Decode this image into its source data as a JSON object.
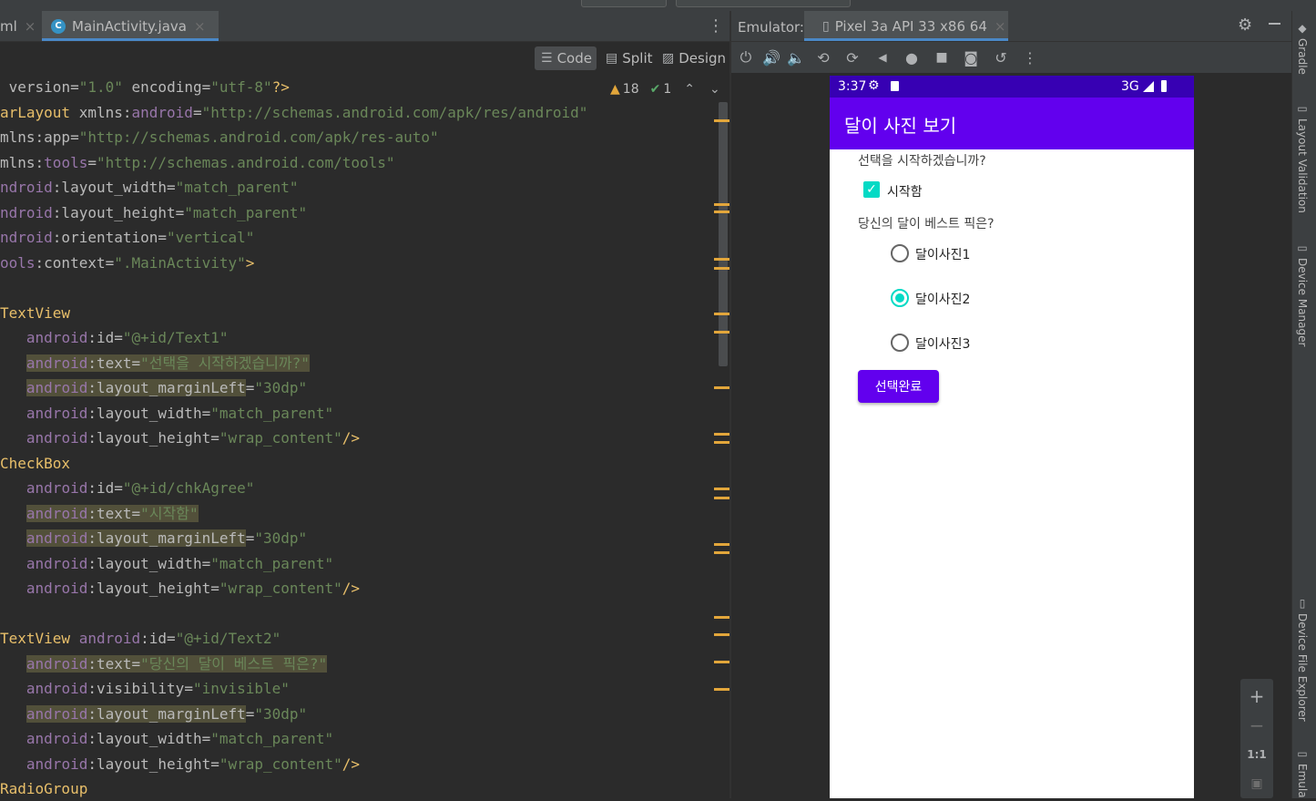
{
  "editor": {
    "tabs": [
      {
        "label": "ml",
        "close": "×"
      },
      {
        "label": "MainActivity.java",
        "close": "×",
        "icon": "C"
      }
    ],
    "kebab": "⋮",
    "modes": {
      "code": "Code",
      "split": "Split",
      "design": "Design"
    },
    "inspections": {
      "warnings": "18",
      "weak_warnings": "1"
    },
    "lines": [
      [
        [
          "punc",
          " "
        ],
        [
          "attr",
          "version"
        ],
        [
          "punc",
          "="
        ],
        [
          "val",
          "\"1.0\""
        ],
        [
          "punc",
          " "
        ],
        [
          "attr",
          "encoding"
        ],
        [
          "punc",
          "="
        ],
        [
          "val",
          "\"utf-8\""
        ],
        [
          "tag",
          "?>"
        ]
      ],
      [
        [
          "tag",
          "arLayout"
        ],
        [
          "punc",
          " "
        ],
        [
          "attr",
          "xmlns:"
        ],
        [
          "ns",
          "android"
        ],
        [
          "punc",
          "="
        ],
        [
          "val",
          "\"http://schemas.android.com/apk/res/android\""
        ]
      ],
      [
        [
          "attr",
          "mlns:app"
        ],
        [
          "punc",
          "="
        ],
        [
          "val",
          "\"http://schemas.android.com/apk/res-auto\""
        ]
      ],
      [
        [
          "attr",
          "mlns:"
        ],
        [
          "ns",
          "tools"
        ],
        [
          "punc",
          "="
        ],
        [
          "val",
          "\"http://schemas.android.com/tools\""
        ]
      ],
      [
        [
          "ns",
          "ndroid"
        ],
        [
          "attr",
          ":layout_width"
        ],
        [
          "punc",
          "="
        ],
        [
          "val",
          "\"match_parent\""
        ]
      ],
      [
        [
          "ns",
          "ndroid"
        ],
        [
          "attr",
          ":layout_height"
        ],
        [
          "punc",
          "="
        ],
        [
          "val",
          "\"match_parent\""
        ]
      ],
      [
        [
          "ns",
          "ndroid"
        ],
        [
          "attr",
          ":orientation"
        ],
        [
          "punc",
          "="
        ],
        [
          "val",
          "\"vertical\""
        ]
      ],
      [
        [
          "ns",
          "ools"
        ],
        [
          "attr",
          ":context"
        ],
        [
          "punc",
          "="
        ],
        [
          "val",
          "\".MainActivity\""
        ],
        [
          "tag",
          ">"
        ]
      ],
      [],
      [
        [
          "tag",
          "TextView"
        ]
      ],
      [
        [
          "punc",
          "   "
        ],
        [
          "ns",
          "android"
        ],
        [
          "attr",
          ":id"
        ],
        [
          "punc",
          "="
        ],
        [
          "val",
          "\"@+id/Text1\""
        ]
      ],
      [
        [
          "punc",
          "   "
        ],
        [
          "hlns",
          "android"
        ],
        [
          "hlattr",
          ":text"
        ],
        [
          "hlpunc",
          "="
        ],
        [
          "hlval",
          "\"선택을 시작하겠습니까?\""
        ]
      ],
      [
        [
          "punc",
          "   "
        ],
        [
          "hlns",
          "android"
        ],
        [
          "hlattr",
          ":layout_marginLeft"
        ],
        [
          "punc",
          "="
        ],
        [
          "val",
          "\"30dp\""
        ]
      ],
      [
        [
          "punc",
          "   "
        ],
        [
          "ns",
          "android"
        ],
        [
          "attr",
          ":layout_width"
        ],
        [
          "punc",
          "="
        ],
        [
          "val",
          "\"match_parent\""
        ]
      ],
      [
        [
          "punc",
          "   "
        ],
        [
          "ns",
          "android"
        ],
        [
          "attr",
          ":layout_height"
        ],
        [
          "punc",
          "="
        ],
        [
          "val",
          "\"wrap_content\""
        ],
        [
          "tag",
          "/>"
        ]
      ],
      [
        [
          "tag",
          "CheckBox"
        ]
      ],
      [
        [
          "punc",
          "   "
        ],
        [
          "ns",
          "android"
        ],
        [
          "attr",
          ":id"
        ],
        [
          "punc",
          "="
        ],
        [
          "val",
          "\"@+id/chkAgree\""
        ]
      ],
      [
        [
          "punc",
          "   "
        ],
        [
          "hlns",
          "android"
        ],
        [
          "hlattr",
          ":text"
        ],
        [
          "hlpunc",
          "="
        ],
        [
          "hlval",
          "\"시작함\""
        ]
      ],
      [
        [
          "punc",
          "   "
        ],
        [
          "hlns",
          "android"
        ],
        [
          "hlattr",
          ":layout_marginLeft"
        ],
        [
          "punc",
          "="
        ],
        [
          "val",
          "\"30dp\""
        ]
      ],
      [
        [
          "punc",
          "   "
        ],
        [
          "ns",
          "android"
        ],
        [
          "attr",
          ":layout_width"
        ],
        [
          "punc",
          "="
        ],
        [
          "val",
          "\"match_parent\""
        ]
      ],
      [
        [
          "punc",
          "   "
        ],
        [
          "ns",
          "android"
        ],
        [
          "attr",
          ":layout_height"
        ],
        [
          "punc",
          "="
        ],
        [
          "val",
          "\"wrap_content\""
        ],
        [
          "tag",
          "/>"
        ]
      ],
      [],
      [
        [
          "tag",
          "TextView"
        ],
        [
          "punc",
          " "
        ],
        [
          "ns",
          "android"
        ],
        [
          "attr",
          ":id"
        ],
        [
          "punc",
          "="
        ],
        [
          "val",
          "\"@+id/Text2\""
        ]
      ],
      [
        [
          "punc",
          "   "
        ],
        [
          "hlns",
          "android"
        ],
        [
          "hlattr",
          ":text"
        ],
        [
          "hlpunc",
          "="
        ],
        [
          "hlval",
          "\"당신의 달이 베스트 픽은?\""
        ]
      ],
      [
        [
          "punc",
          "   "
        ],
        [
          "ns",
          "android"
        ],
        [
          "attr",
          ":visibility"
        ],
        [
          "punc",
          "="
        ],
        [
          "val",
          "\"invisible\""
        ]
      ],
      [
        [
          "punc",
          "   "
        ],
        [
          "hlns",
          "android"
        ],
        [
          "hlattr",
          ":layout_marginLeft"
        ],
        [
          "punc",
          "="
        ],
        [
          "val",
          "\"30dp\""
        ]
      ],
      [
        [
          "punc",
          "   "
        ],
        [
          "ns",
          "android"
        ],
        [
          "attr",
          ":layout_width"
        ],
        [
          "punc",
          "="
        ],
        [
          "val",
          "\"match_parent\""
        ]
      ],
      [
        [
          "punc",
          "   "
        ],
        [
          "ns",
          "android"
        ],
        [
          "attr",
          ":layout_height"
        ],
        [
          "punc",
          "="
        ],
        [
          "val",
          "\"wrap_content\""
        ],
        [
          "tag",
          "/>"
        ]
      ],
      [
        [
          "tag",
          "RadioGroup"
        ]
      ]
    ]
  },
  "emulator": {
    "label": "Emulator:",
    "device_tab": "Pixel 3a API 33 x86 64",
    "close": "×",
    "toolbar": [
      "power-icon",
      "volume-up-icon",
      "volume-down-icon",
      "rotate-left-icon",
      "rotate-right-icon",
      "back-icon",
      "home-icon",
      "overview-icon",
      "screenshot-icon",
      "snapshot-icon",
      "more-icon"
    ],
    "zoom": {
      "plus": "+",
      "minus": "−",
      "one_to_one": "1:1"
    }
  },
  "device": {
    "time": "3:37",
    "network": "3G",
    "app_title": "달이 사진 보기",
    "prompt1": "선택을 시작하겠습니까?",
    "checkbox_label": "시작함",
    "checkbox_checked": true,
    "prompt2": "당신의 달이 베스트 픽은?",
    "radios": [
      {
        "label": "달이사진1",
        "selected": false
      },
      {
        "label": "달이사진2",
        "selected": true
      },
      {
        "label": "달이사진3",
        "selected": false
      }
    ],
    "done_button": "선택완료",
    "colors": {
      "primary": "#6200ee",
      "primary_dark": "#3700b3",
      "accent": "#03dac5"
    }
  },
  "right_strip": [
    "Gradle",
    "Layout Validation",
    "Device Manager",
    "Device File Explorer",
    "Emula"
  ]
}
